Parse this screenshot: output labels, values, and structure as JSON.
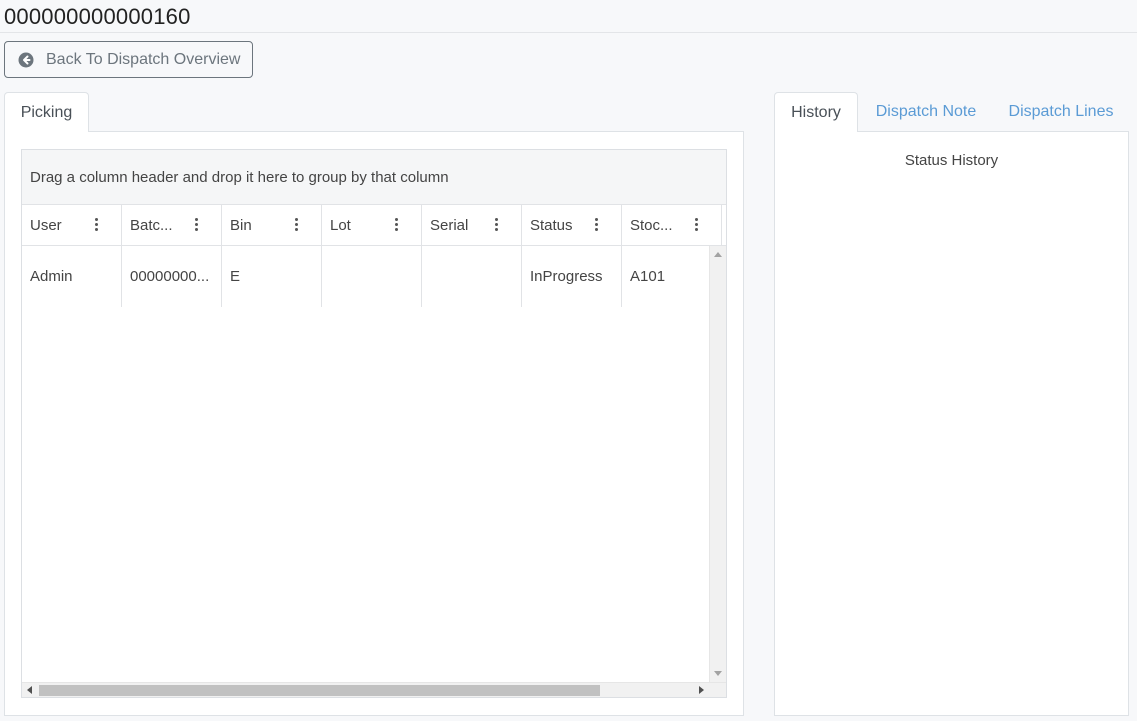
{
  "page": {
    "title": "000000000000160",
    "back_button_label": "Back To Dispatch Overview",
    "back_icon": "arrow-circle-left-icon"
  },
  "left_tabs": [
    {
      "label": "Picking",
      "active": true
    }
  ],
  "grid": {
    "group_hint": "Drag a column header and drop it here to group by that column",
    "columns": [
      "User",
      "Batc...",
      "Bin",
      "Lot",
      "Serial",
      "Status",
      "Stoc..."
    ],
    "rows": [
      [
        "Admin",
        "00000000...",
        "E",
        "",
        "",
        "InProgress",
        "A101"
      ]
    ]
  },
  "right_tabs": [
    {
      "label": "History",
      "active": true
    },
    {
      "label": "Dispatch Note",
      "active": false
    },
    {
      "label": "Dispatch Lines",
      "active": false
    }
  ],
  "history": {
    "heading": "Status History"
  },
  "colors": {
    "link": "#5b9bd5",
    "border": "#dee2e6",
    "button_border": "#6c757d"
  }
}
